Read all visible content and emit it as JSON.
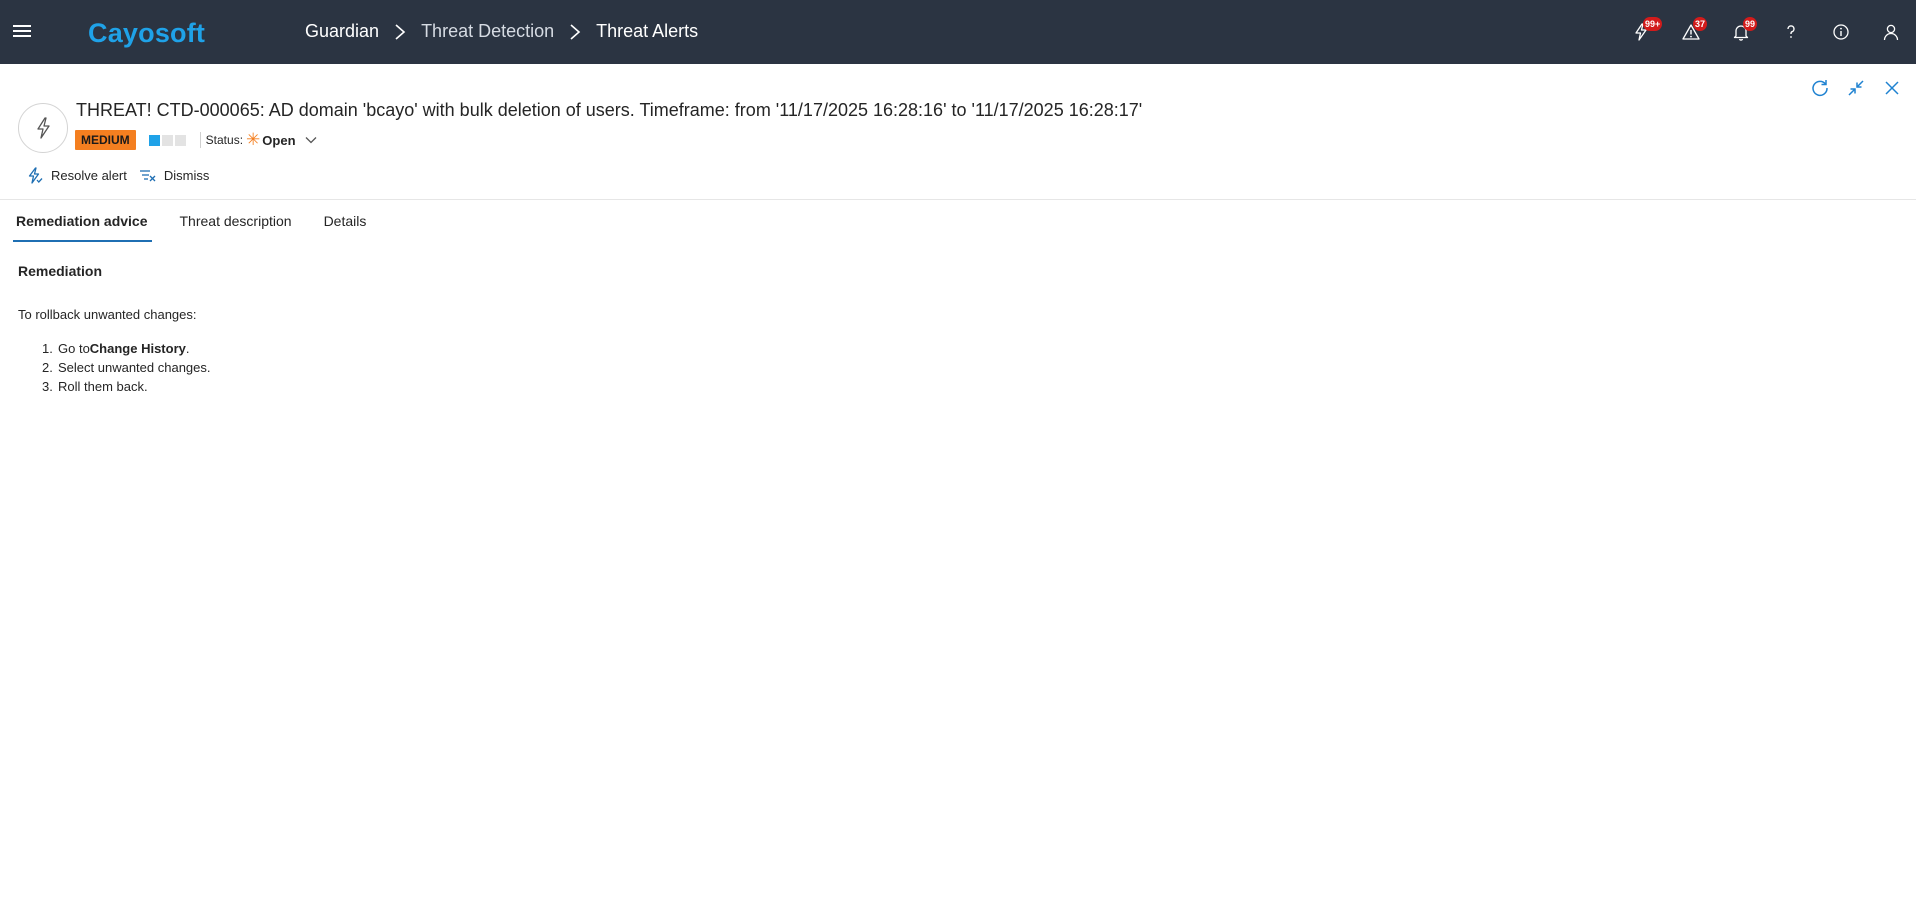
{
  "app": {
    "logo": "Cayosoft",
    "breadcrumb": [
      "Guardian",
      "Threat Detection",
      "Threat Alerts"
    ]
  },
  "top_icons": [
    {
      "name": "threats-icon",
      "badge": "99+"
    },
    {
      "name": "warning-icon",
      "badge": "37"
    },
    {
      "name": "bell-icon",
      "badge": "99"
    },
    {
      "name": "help-icon",
      "badge": ""
    },
    {
      "name": "info-icon",
      "badge": ""
    },
    {
      "name": "user-icon",
      "badge": ""
    }
  ],
  "alert": {
    "title": "THREAT! CTD-000065: AD domain 'bcayo' with bulk deletion of users. Timeframe: from '11/17/2025 16:28:16' to '11/17/2025 16:28:17'",
    "severity": "MEDIUM",
    "severity_level": 1,
    "severity_max": 3,
    "status_label": "Status:",
    "status_value": "Open"
  },
  "commands": {
    "resolve": "Resolve alert",
    "dismiss": "Dismiss"
  },
  "tabs": [
    "Remediation advice",
    "Threat description",
    "Details"
  ],
  "content": {
    "heading": "Remediation",
    "intro": "To rollback unwanted changes:",
    "steps": [
      {
        "num": "1.",
        "prefix": "Go to ",
        "bold": "Change History",
        "suffix": "."
      },
      {
        "num": "2.",
        "prefix": "Select unwanted changes.",
        "bold": "",
        "suffix": ""
      },
      {
        "num": "3.",
        "prefix": "Roll them back.",
        "bold": "",
        "suffix": ""
      }
    ]
  },
  "colors": {
    "topbar": "#2b3442",
    "brand": "#1fa2e8",
    "severity_medium": "#f47f20",
    "badge": "#d21b1b",
    "tab_underline": "#1f6fb3"
  }
}
